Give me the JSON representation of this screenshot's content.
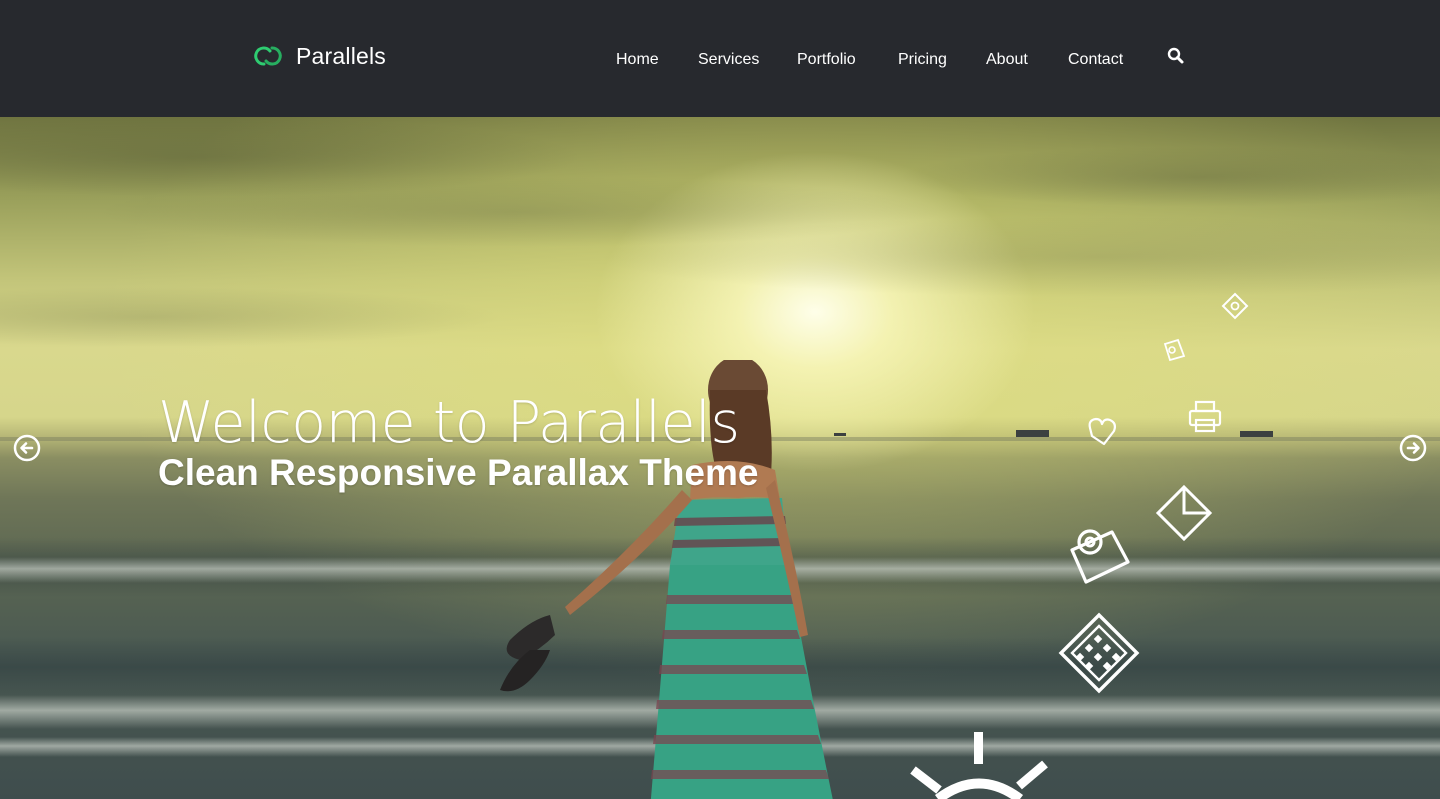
{
  "header": {
    "logo_text": "Parallels",
    "nav": [
      {
        "label": "Home"
      },
      {
        "label": "Services"
      },
      {
        "label": "Portfolio"
      },
      {
        "label": "Pricing"
      },
      {
        "label": "About"
      },
      {
        "label": "Contact"
      }
    ],
    "search_icon": "search-icon"
  },
  "hero": {
    "title": "Welcome to Parallels",
    "subtitle": "Clean Responsive Parallax Theme",
    "prev_icon": "arrow-left-circle-icon",
    "next_icon": "arrow-right-circle-icon",
    "floating_icons": [
      "tag-icon",
      "tag-icon",
      "printer-icon",
      "heart-icon",
      "envelope-icon",
      "photo-icon",
      "calendar-icon",
      "lightbulb-icon"
    ]
  },
  "colors": {
    "header_bg": "#27292e",
    "logo_green": "#2ecc71",
    "text_white": "#ffffff"
  }
}
